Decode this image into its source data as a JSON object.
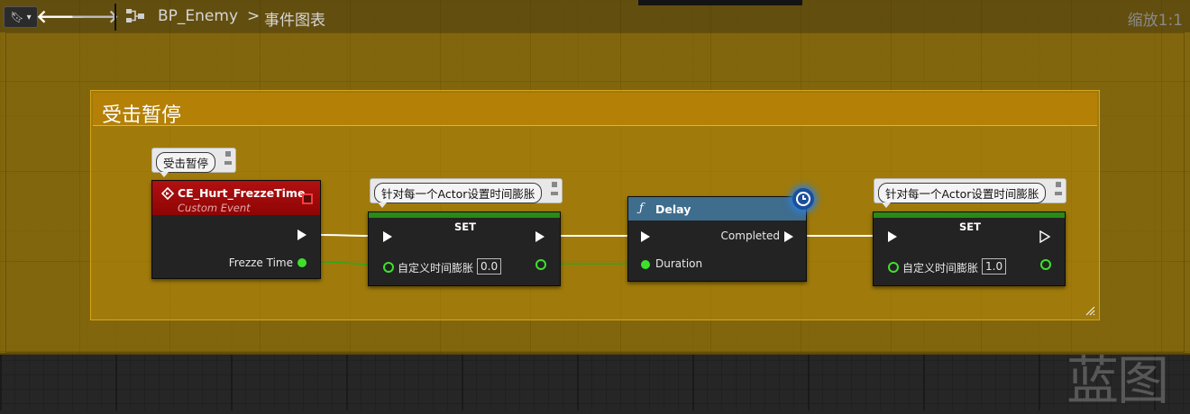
{
  "toolbar": {
    "breadcrumb_blueprint": "BP_Enemy",
    "breadcrumb_separator": ">",
    "breadcrumb_graph": "事件图表",
    "zoom": "缩放1:1"
  },
  "comment": {
    "title": "受击暂停"
  },
  "event_node": {
    "bubble": "受击暂停",
    "title": "CE_Hurt_FrezzeTime",
    "subtitle": "Custom Event",
    "output_label": "Frezze Time"
  },
  "set_node_1": {
    "bubble": "针对每一个Actor设置时间膨胀",
    "title": "SET",
    "input_label": "自定义时间膨胀",
    "input_value": "0.0"
  },
  "delay_node": {
    "icon": "ƒ",
    "title": "Delay",
    "output_label": "Completed",
    "input_label": "Duration"
  },
  "set_node_2": {
    "bubble": "针对每一个Actor设置时间膨胀",
    "title": "SET",
    "input_label": "自定义时间膨胀",
    "input_value": "1.0"
  },
  "watermark": "蓝图",
  "colors": {
    "comment": "#b48005",
    "event_header": "#a40a0a",
    "set_bar": "#2b8a14",
    "delay_header": "#3f6d8e",
    "float_pin": "#3fe02d"
  }
}
